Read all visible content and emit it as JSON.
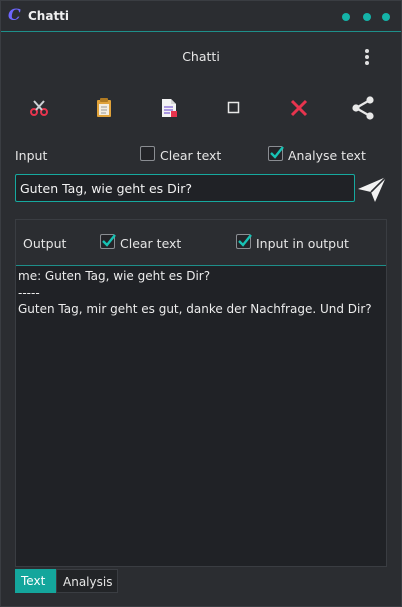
{
  "titlebar": {
    "title": "Chatti",
    "icon": "C"
  },
  "header": {
    "title": "Chatti"
  },
  "toolbar": {
    "items": [
      "cut-icon",
      "paste-icon",
      "document-icon",
      "square-icon",
      "close-icon",
      "share-icon"
    ]
  },
  "input_section": {
    "label": "Input",
    "clear_text_label": "Clear text",
    "clear_text_checked": false,
    "analyse_text_label": "Analyse text",
    "analyse_text_checked": true,
    "input_value": "Guten Tag, wie geht es Dir?"
  },
  "output_section": {
    "label": "Output",
    "clear_text_label": "Clear text",
    "clear_text_checked": true,
    "input_in_output_label": "Input in output",
    "input_in_output_checked": true,
    "text": "me: Guten Tag, wie geht es Dir?\n-----\nGuten Tag, mir geht es gut, danke der Nachfrage. Und Dir?"
  },
  "tabs": [
    {
      "label": "Text",
      "active": true
    },
    {
      "label": "Analysis",
      "active": false
    }
  ],
  "colors": {
    "accent": "#14a69c",
    "close_red": "#e8344e",
    "app_icon": "#6e66ff"
  }
}
